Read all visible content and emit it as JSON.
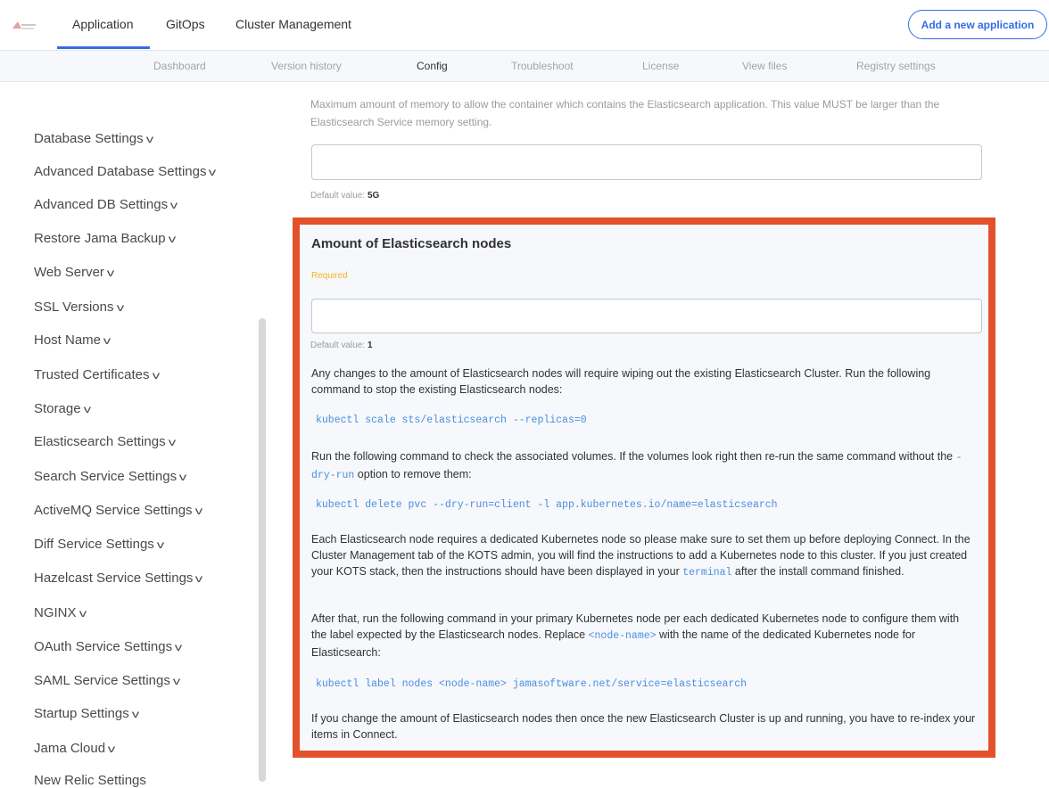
{
  "topnav": {
    "tabs": [
      "Application",
      "GitOps",
      "Cluster Management"
    ],
    "add_button": "Add a new application"
  },
  "subnav": {
    "tabs": [
      "Dashboard",
      "Version history",
      "Config",
      "Troubleshoot",
      "License",
      "View files",
      "Registry settings"
    ],
    "active": "Config"
  },
  "sidebar": {
    "items": [
      "Database Settings",
      "Advanced Database Settings",
      "Advanced DB Settings",
      "Restore Jama Backup",
      "Web Server",
      "SSL Versions",
      "Host Name",
      "Trusted Certificates",
      "Storage",
      "Elasticsearch Settings",
      "Search Service Settings",
      "ActiveMQ Service Settings",
      "Diff Service Settings",
      "Hazelcast Service Settings",
      "NGINX",
      "OAuth Service Settings",
      "SAML Service Settings",
      "Startup Settings",
      "Jama Cloud",
      "New Relic Settings"
    ]
  },
  "memory_field": {
    "description": "Maximum amount of memory to allow the container which contains the Elasticsearch application. This value MUST be larger than the Elasticsearch Service memory setting.",
    "value": "",
    "default_label": "Default value:",
    "default_value": "5G"
  },
  "nodes_field": {
    "title": "Amount of Elasticsearch nodes",
    "required_label": "Required",
    "value": "",
    "default_label": "Default value:",
    "default_value": "1",
    "para1": "Any changes to the amount of Elasticsearch nodes will require wiping out the existing Elasticsearch Cluster. Run the following command to stop the existing Elasticsearch nodes:",
    "cmd1": "kubectl scale sts/elasticsearch --replicas=0",
    "para2_a": "Run the following command to check the associated volumes. If the volumes look right then re-run the same command without the",
    "para2_code": "-dry-run",
    "para2_b": "option to remove them:",
    "cmd2": "kubectl delete pvc --dry-run=client -l app.kubernetes.io/name=elasticsearch",
    "para3_a": "Each Elasticsearch node requires a dedicated Kubernetes node so please make sure to set them up before deploying Connect. In the Cluster Management tab of the KOTS admin, you will find the instructions to add a Kubernetes node to this cluster. If you just created your KOTS stack, then the instructions should have been displayed in your",
    "para3_code": "terminal",
    "para3_b": "after the install command finished.",
    "para4_a": "After that, run the following command in your primary Kubernetes node per each dedicated Kubernetes node to configure them with the label expected by the Elasticsearch nodes. Replace",
    "para4_code": "<node-name>",
    "para4_b": "with the name of the dedicated Kubernetes node for Elasticsearch:",
    "cmd3": "kubectl label nodes <node-name> jamasoftware.net/service=elasticsearch",
    "para5": "If you change the amount of Elasticsearch nodes then once the new Elasticsearch Cluster is up and running, you have to re-index your items in Connect."
  },
  "colors": {
    "accent": "#326de6",
    "highlight": "#e2512b",
    "required": "#f5b623",
    "code": "#4a8ee0"
  }
}
